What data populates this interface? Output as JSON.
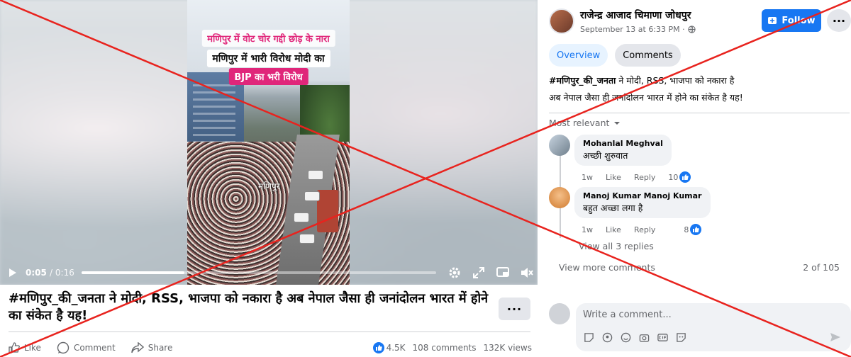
{
  "video": {
    "caption_line1": "मणिपुर में वोट चोर गद्दी छोड़ के नारा",
    "caption_line2": "मणिपुर में भारी विरोध मोदी का",
    "caption_line3": "BJP का भरी विरोध",
    "location_label": "मणिपुर",
    "time_current": "0:05",
    "time_total": "/ 0:16",
    "progress": 0.29,
    "icons": [
      "play-icon",
      "settings-icon",
      "fullscreen-icon",
      "pip-icon",
      "mute-icon"
    ]
  },
  "post": {
    "title": "#मणिपुर_की_जनता ने मोदी, RSS, भाजपा को नकारा है अब नेपाल जैसा ही जनांदोलन भारत में होने का संकेत है यह!",
    "more_label": "···",
    "like_label": "Like",
    "comment_label": "Comment",
    "share_label": "Share",
    "reactions": "4.5K",
    "comments_count": "108 comments",
    "views": "132K views"
  },
  "panel": {
    "author": "राजेन्द्र आजाद चिमाणा जोधपुर",
    "date": "September 13 at 6:33 PM ·",
    "follow_label": "Follow",
    "dots_label": "···",
    "tabs": [
      {
        "label": "Overview"
      },
      {
        "label": "Comments"
      }
    ],
    "caption_hashtag": "#मणिपुर_की_जनता",
    "caption_rest": " ने मोदी, RSS, भाजपा को नकारा है",
    "caption_line2": "अब नेपाल जैसा ही जनांदोलन भारत में होने का संकेत है यह!",
    "sort_label": "Most relevant",
    "comments": [
      {
        "name": "Mohanlal Meghval",
        "text": "अच्छी शुरुवात",
        "age": "1w",
        "like": "Like",
        "reply": "Reply",
        "count": "10"
      },
      {
        "name": "Manoj Kumar Manoj Kumar",
        "text": "बहुत अच्छा लगा है",
        "age": "1w",
        "like": "Like",
        "reply": "Reply",
        "count": "8"
      }
    ],
    "view_replies": "View all 3 replies",
    "view_more": "View more comments",
    "pagination": "2 of 105",
    "compose_placeholder": "Write a comment..."
  },
  "colors": {
    "accent": "#1877f2",
    "overlay_x": "#e8231e",
    "panel_bg": "#ffffff"
  }
}
